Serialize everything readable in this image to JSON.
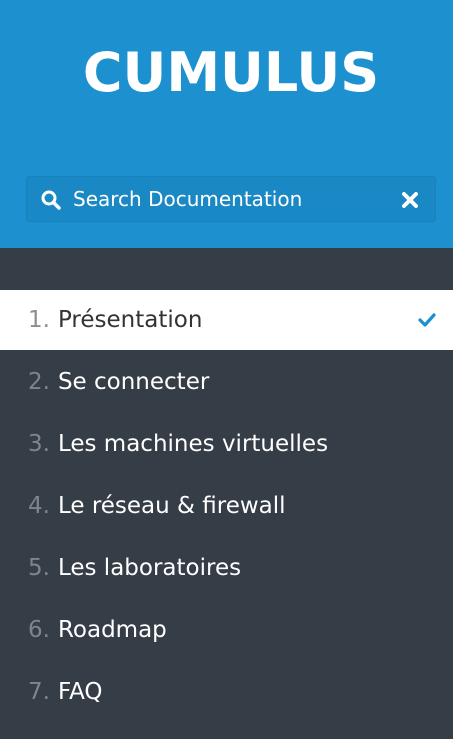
{
  "header": {
    "brand": "CUMULUS",
    "background_color": "#1d91d0"
  },
  "search": {
    "placeholder": "Search Documentation",
    "value": "",
    "icon": "search-icon",
    "clear_icon": "close-icon"
  },
  "nav": {
    "items": [
      {
        "num": "1.",
        "label": "Présentation",
        "active": true,
        "icon": "check-icon"
      },
      {
        "num": "2.",
        "label": "Se connecter"
      },
      {
        "num": "3.",
        "label": "Les machines virtuelles"
      },
      {
        "num": "4.",
        "label": "Le réseau & firewall"
      },
      {
        "num": "5.",
        "label": "Les laboratoires"
      },
      {
        "num": "6.",
        "label": "Roadmap"
      },
      {
        "num": "7.",
        "label": "FAQ"
      }
    ],
    "active_color": "#1d91d0"
  }
}
